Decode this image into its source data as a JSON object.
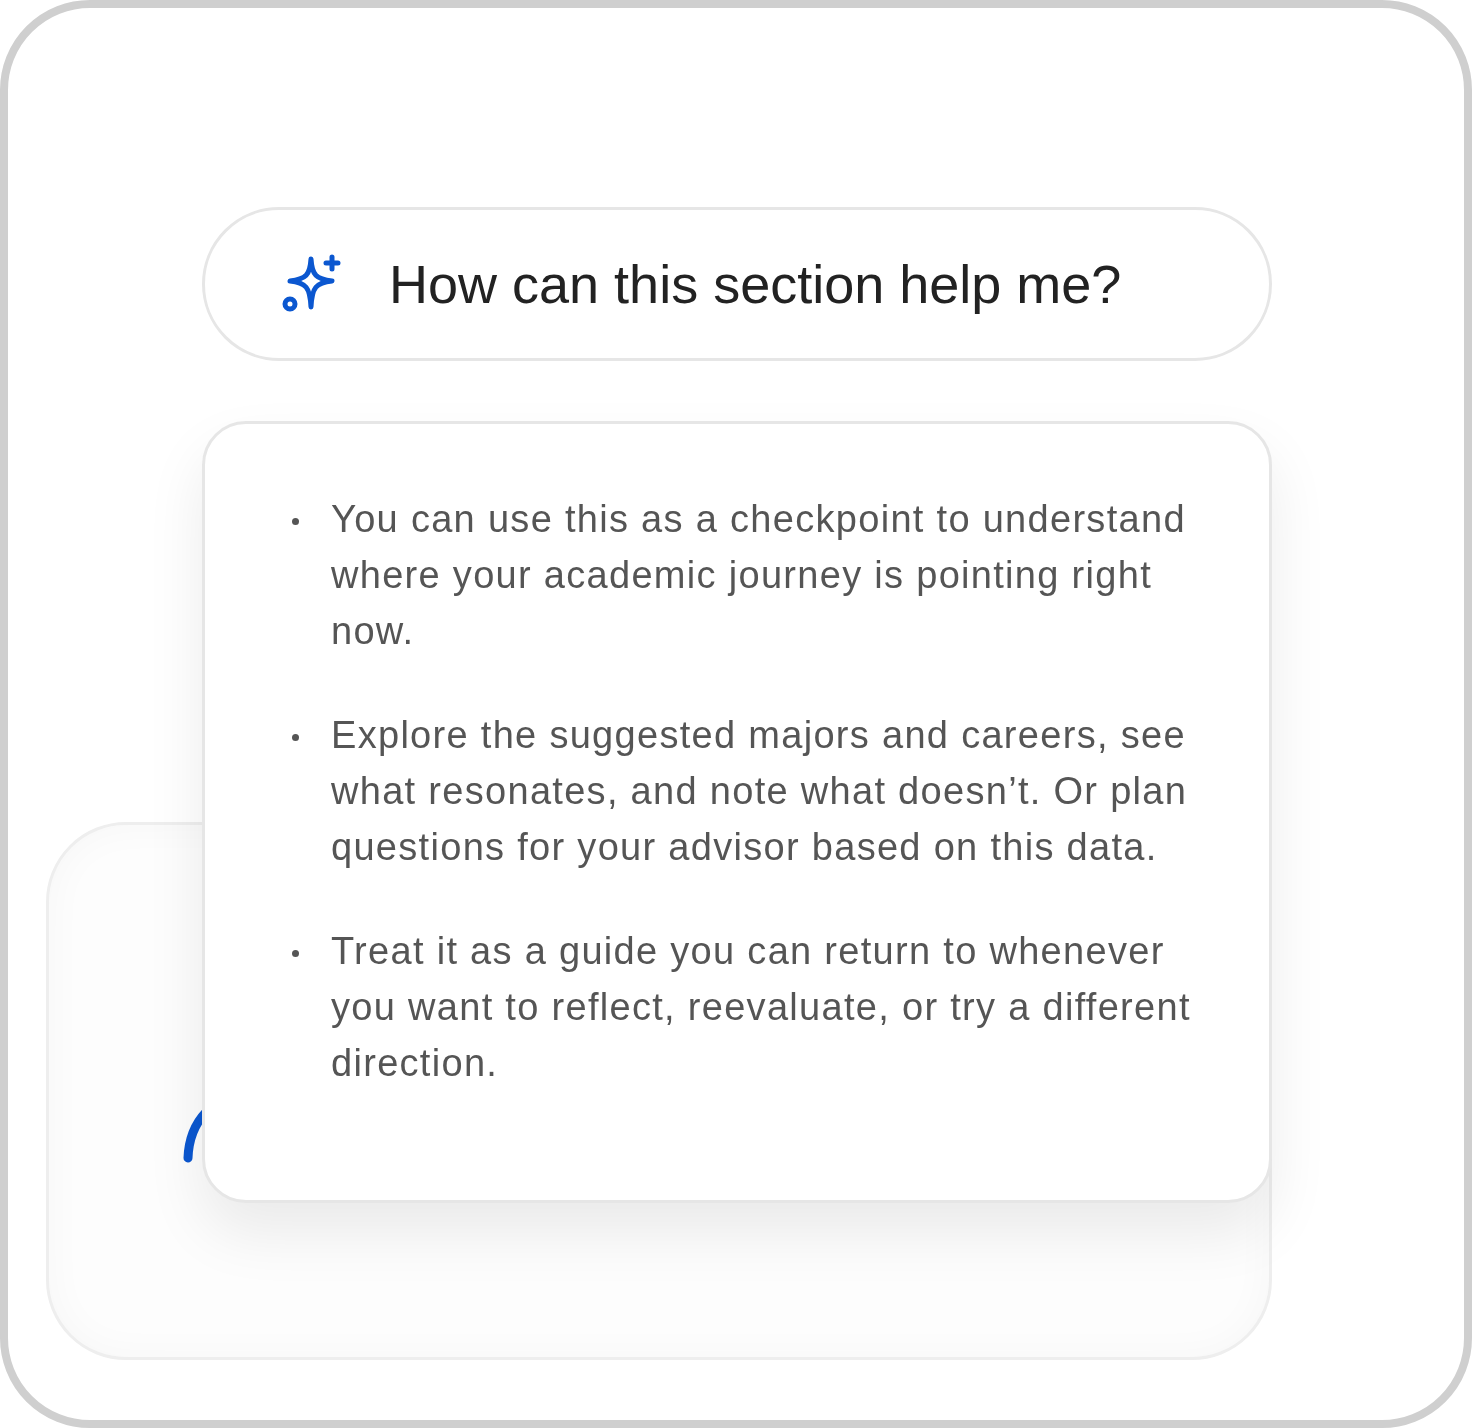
{
  "prompt_button": {
    "label": "How can this section help me?"
  },
  "popover": {
    "items": [
      "You can use this as a checkpoint to understand where your academic journey is pointing right now.",
      "Explore the suggested majors and careers, see what resonates, and note what doesn’t. Or plan questions for your advisor based on this data.",
      "Treat it as a guide you can return to whenever you want to reflect, reevaluate, or try a different direction."
    ]
  }
}
